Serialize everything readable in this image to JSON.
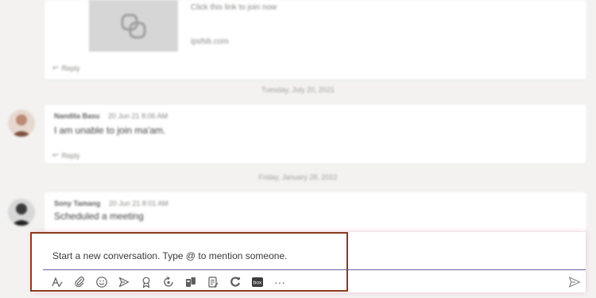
{
  "feed": {
    "link_preview": {
      "text": "Click this link to join now",
      "site": "ipsfsb.com"
    },
    "reply_label": "Reply",
    "date_separators": [
      "Tuesday, July 20, 2021",
      "Friday, January 28, 2022"
    ],
    "messages": [
      {
        "author": "Nandita Basu",
        "time": "20 Jun 21 8:06 AM",
        "text": "I am unable to join ma'am."
      },
      {
        "author": "Sony Tamang",
        "time": "20 Jun 21 8:01 AM",
        "text": "Scheduled a meeting"
      }
    ]
  },
  "compose": {
    "placeholder": "Start a new conversation. Type @ to mention someone.",
    "toolbar_icons": [
      "format-icon",
      "attach-icon",
      "emoji-icon",
      "gif-icon",
      "praise-icon",
      "loop-icon",
      "stream-icon",
      "forms-icon",
      "approvals-icon",
      "box-icon",
      "more-icon"
    ],
    "box_label": "box",
    "more_label": "···"
  },
  "colors": {
    "accent": "#6264a7",
    "highlight_border": "#8a3a1a",
    "background": "#f3f2f1"
  }
}
